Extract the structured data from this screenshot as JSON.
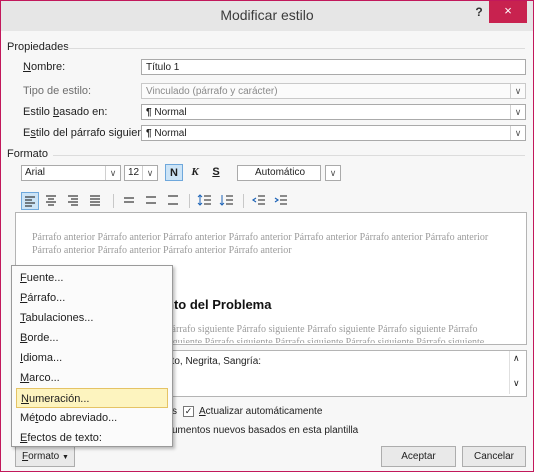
{
  "window": {
    "title": "Modificar estilo",
    "help_glyph": "?",
    "close_glyph": "×"
  },
  "properties": {
    "section": "Propiedades",
    "name_label": "Nombre:",
    "name_value": "Título 1",
    "type_label": "Tipo de estilo:",
    "type_value": "Vinculado (párrafo y carácter)",
    "based_label": "Estilo basado en:",
    "based_value": "Normal",
    "next_label": "Estilo del párrafo siguiente:",
    "next_value": "Normal",
    "paragraph_mark": "¶"
  },
  "format": {
    "section": "Formato",
    "font": "Arial",
    "size": "12",
    "bold": "N",
    "italic": "K",
    "underline": "S",
    "color": "Automático",
    "bold_active": true
  },
  "preview": {
    "prev_text": "Párrafo anterior Párrafo anterior Párrafo anterior Párrafo anterior Párrafo anterior Párrafo anterior Párrafo anterior Párrafo anterior Párrafo anterior Párrafo anterior Párrafo anterior",
    "heading": "nto del Problema",
    "next_text": "Párrafo siguiente Párrafo siguiente Párrafo siguiente Párrafo siguiente Párrafo siguiente Párrafo siguiente Párrafo siguiente Párrafo siguiente Párrafo siguiente Párrafo siguiente"
  },
  "description": {
    "text": "pto, Negrita, Sangría:"
  },
  "options": {
    "add_gallery_fragment": "s",
    "auto_update_label": "Actualizar automáticamente",
    "auto_update_checked": true,
    "new_docs_fragment": "umentos nuevos basados en esta plantilla"
  },
  "buttons": {
    "formato": "Formato",
    "accept": "Aceptar",
    "cancel": "Cancelar"
  },
  "menu": {
    "items": [
      {
        "label": "Fuente...",
        "accel": "F"
      },
      {
        "label": "Párrafo...",
        "accel": "P"
      },
      {
        "label": "Tabulaciones...",
        "accel": "T"
      },
      {
        "label": "Borde...",
        "accel": "B"
      },
      {
        "label": "Idioma...",
        "accel": "I"
      },
      {
        "label": "Marco...",
        "accel": "M"
      },
      {
        "label": "Numeración...",
        "accel": "N"
      },
      {
        "label": "Método abreviado...",
        "accel": "t"
      },
      {
        "label": "Efectos de texto:",
        "accel": "E"
      }
    ],
    "highlighted_index": 6
  },
  "colors": {
    "accent": "#c8224f",
    "highlight": "#fdf4bf",
    "pressed": "#cce4f7"
  }
}
